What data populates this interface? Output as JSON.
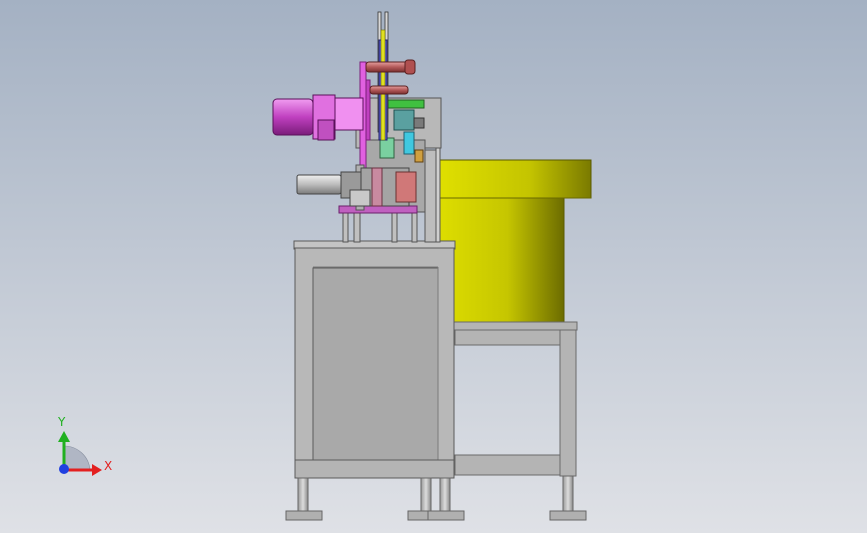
{
  "viewport": {
    "background_top": "#a4b1c3",
    "background_bottom": "#dfe1e6"
  },
  "triad": {
    "x_label": "X",
    "y_label": "Y",
    "x_color": "#e32020",
    "y_color": "#20b020",
    "z_color": "#2040e0"
  },
  "model": {
    "frame_color": "#b4b4b4",
    "hopper_color": "#c8c800",
    "mechanism_accent": "#e060e0",
    "rollers_color": "#c87070",
    "cylinder_color": "#cfcfcf"
  }
}
